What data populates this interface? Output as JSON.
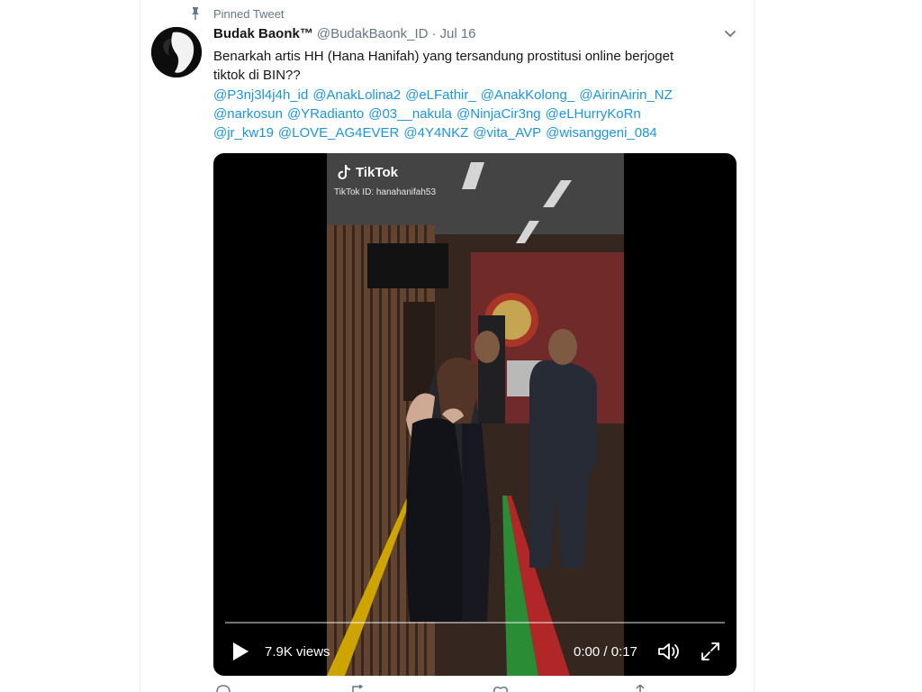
{
  "pinned": {
    "label": "Pinned Tweet",
    "icon": "pin-icon"
  },
  "author": {
    "name": "Budak Baonk™",
    "handle": "@BudakBaonk_ID",
    "separator": "·",
    "date": "Jul 16"
  },
  "tweet": {
    "text_line1": "Benarkah artis HH (Hana Hanifah) yang tersandung prostitusi online berjoget",
    "text_line2": "tiktok di BIN??",
    "mentions": [
      [
        "@P3nj3l4j4h_id",
        "@AnakLolina2",
        "@eLFathir_",
        "@AnakKolong_",
        "@AirinAirin_NZ"
      ],
      [
        "@narkosun",
        "@YRadianto",
        "@03__nakula",
        "@NinjaCir3ng",
        "@eLHurryKoRn"
      ],
      [
        "@jr_kw19",
        "@LOVE_AG4EVER",
        "@4Y4NKZ",
        "@vita_AVP",
        "@wisanggeni_084"
      ]
    ]
  },
  "video": {
    "brand": "TikTok",
    "tiktok_id": "TikTok ID: hanahanifah53",
    "views": "7.9K views",
    "time": "0:00 / 0:17",
    "progress": 0
  },
  "colors": {
    "link": "#1b95e0",
    "secondary_text": "#657786",
    "primary_text": "#14171a"
  }
}
